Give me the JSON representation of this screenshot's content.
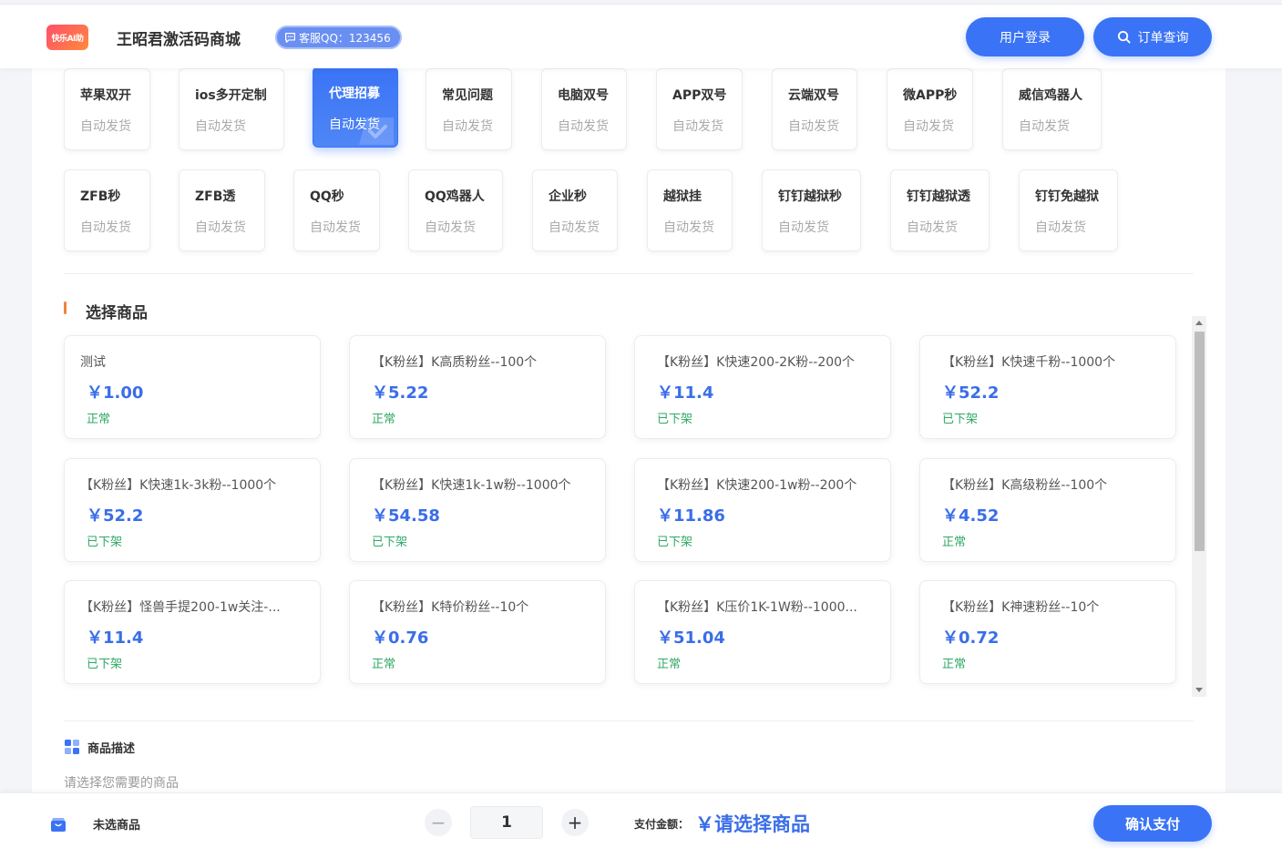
{
  "header": {
    "logo_text": "快乐AI助",
    "site_title": "王昭君激活码商城",
    "qq_label": "客服QQ：123456",
    "login_label": "用户登录",
    "query_label": "订单查询"
  },
  "categories": [
    {
      "name": "苹果双开",
      "sub": "自动发货",
      "active": false
    },
    {
      "name": "ios多开定制",
      "sub": "自动发货",
      "active": false
    },
    {
      "name": "代理招募",
      "sub": "自动发货",
      "active": true
    },
    {
      "name": "常见问题",
      "sub": "自动发货",
      "active": false
    },
    {
      "name": "电脑双号",
      "sub": "自动发货",
      "active": false
    },
    {
      "name": "APP双号",
      "sub": "自动发货",
      "active": false
    },
    {
      "name": "云端双号",
      "sub": "自动发货",
      "active": false
    },
    {
      "name": "微APP秒",
      "sub": "自动发货",
      "active": false
    },
    {
      "name": "威信鸡器人",
      "sub": "自动发货",
      "active": false
    },
    {
      "name": "ZFB秒",
      "sub": "自动发货",
      "active": false
    },
    {
      "name": "ZFB透",
      "sub": "自动发货",
      "active": false
    },
    {
      "name": "QQ秒",
      "sub": "自动发货",
      "active": false
    },
    {
      "name": "QQ鸡器人",
      "sub": "自动发货",
      "active": false
    },
    {
      "name": "企业秒",
      "sub": "自动发货",
      "active": false
    },
    {
      "name": "越狱挂",
      "sub": "自动发货",
      "active": false
    },
    {
      "name": "钉钉越狱秒",
      "sub": "自动发货",
      "active": false
    },
    {
      "name": "钉钉越狱透",
      "sub": "自动发货",
      "active": false
    },
    {
      "name": "钉钉免越狱",
      "sub": "自动发货",
      "active": false
    }
  ],
  "products_section": {
    "title": "选择商品",
    "items": [
      {
        "name": "测试",
        "price": "￥1.00",
        "status": "正常"
      },
      {
        "name": "【K粉丝】K高质粉丝--100个",
        "price": "￥5.22",
        "status": "正常"
      },
      {
        "name": "【K粉丝】K快速200-2K粉--200个",
        "price": "￥11.4",
        "status": "已下架"
      },
      {
        "name": "【K粉丝】K快速千粉--1000个",
        "price": "￥52.2",
        "status": "已下架"
      },
      {
        "name": "【K粉丝】K快速1k-3k粉--1000个",
        "price": "￥52.2",
        "status": "已下架"
      },
      {
        "name": "【K粉丝】K快速1k-1w粉--1000个",
        "price": "￥54.58",
        "status": "已下架"
      },
      {
        "name": "【K粉丝】K快速200-1w粉--200个",
        "price": "￥11.86",
        "status": "已下架"
      },
      {
        "name": "【K粉丝】K高级粉丝--100个",
        "price": "￥4.52",
        "status": "正常"
      },
      {
        "name": "【K粉丝】怪兽手提200-1w关注-...",
        "price": "￥11.4",
        "status": "已下架"
      },
      {
        "name": "【K粉丝】K特价粉丝--10个",
        "price": "￥0.76",
        "status": "正常"
      },
      {
        "name": "【K粉丝】K压价1K-1W粉--1000...",
        "price": "￥51.04",
        "status": "正常"
      },
      {
        "name": "【K粉丝】K神速粉丝--10个",
        "price": "￥0.72",
        "status": "正常"
      }
    ]
  },
  "description": {
    "title": "商品描述",
    "text": "请选择您需要的商品"
  },
  "footer": {
    "product_label": "未选商品",
    "quantity": "1",
    "minus": "−",
    "plus": "+",
    "pay_label": "支付金额：",
    "pay_amount": "￥请选择商品",
    "confirm_label": "确认支付"
  },
  "colors": {
    "accent": "#3a73f5",
    "price": "#3a6ee8",
    "status_ok": "#2fa864",
    "section_marker": "#f0843c"
  }
}
